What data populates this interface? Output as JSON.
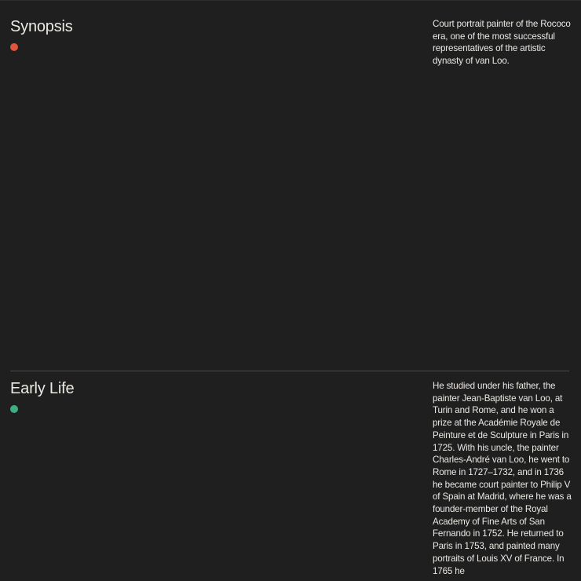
{
  "sections": [
    {
      "title": "Synopsis",
      "dot_color": "#e2553d",
      "body": "Court portrait painter of the Rococo era, one of the most successful representatives of the artistic dynasty of van Loo."
    },
    {
      "title": "Early Life",
      "dot_color": "#3fae7f",
      "body": "He studied under his father, the painter Jean-Baptiste van Loo, at Turin and Rome, and he won a prize at the Académie Royale de Peinture et de Sculpture in Paris in 1725. With his uncle, the painter Charles-André van Loo, he went to Rome in 1727–1732, and in 1736 he became court painter to Philip V of Spain at Madrid, where he was a founder-member of the Royal Academy of Fine Arts of San Fernando in 1752. He returned to Paris in 1753, and painted many portraits of Louis XV of France. In 1765 he"
    }
  ]
}
